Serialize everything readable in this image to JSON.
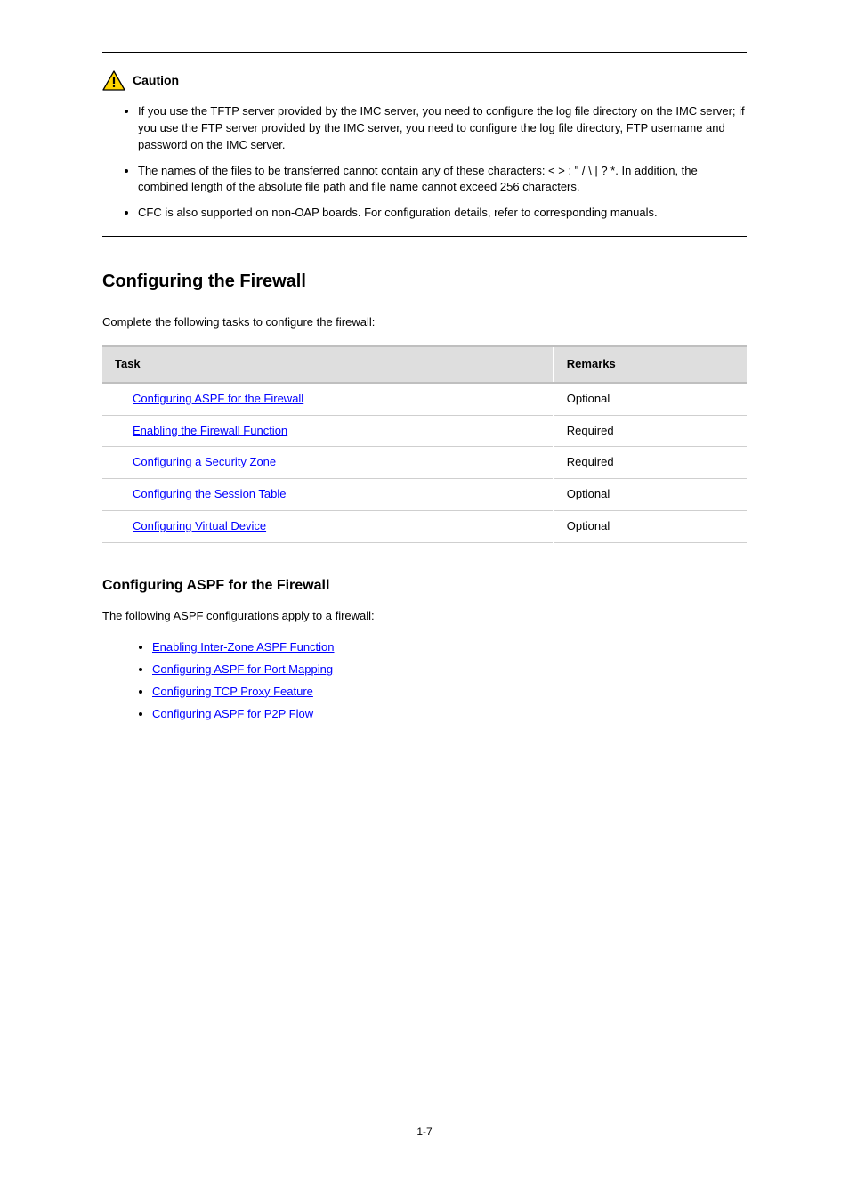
{
  "caution": {
    "label": "Caution",
    "bullet1": "If you use the TFTP server provided by the IMC server, you need to configure the log file directory on the IMC server; if you use the FTP server provided by the IMC server, you need to configure the log file directory, FTP username and password on the IMC server.",
    "bullet2": "The names of the files to be transferred cannot contain any of these characters: < > : \" / \\ | ? *. In addition, the combined length of the absolute file path and file name cannot exceed 256 characters.",
    "bullet3": "CFC is also supported on non-OAP boards. For configuration details, refer to corresponding manuals."
  },
  "sectionTitle": "Configuring the Firewall",
  "tableIntro": "Complete the following tasks to configure the firewall:",
  "table": {
    "headers": {
      "task": "Task",
      "remarks": "Remarks"
    },
    "rows": [
      {
        "task": "Configuring ASPF for the Firewall",
        "remarks": "Optional"
      },
      {
        "task": "Enabling the Firewall Function",
        "remarks": "Required"
      },
      {
        "task": "Configuring a Security Zone",
        "remarks": "Required"
      },
      {
        "task": "Configuring the Session Table",
        "remarks": "Optional"
      },
      {
        "task": "Configuring Virtual Device",
        "remarks": "Optional"
      }
    ]
  },
  "aspf": {
    "title": "Configuring ASPF for the Firewall",
    "intro": "The following ASPF configurations apply to a firewall:",
    "links": [
      "Enabling Inter-Zone ASPF Function",
      "Configuring ASPF for Port Mapping",
      "Configuring TCP Proxy Feature",
      "Configuring ASPF for P2P Flow"
    ]
  },
  "pageNumber": "1-7"
}
